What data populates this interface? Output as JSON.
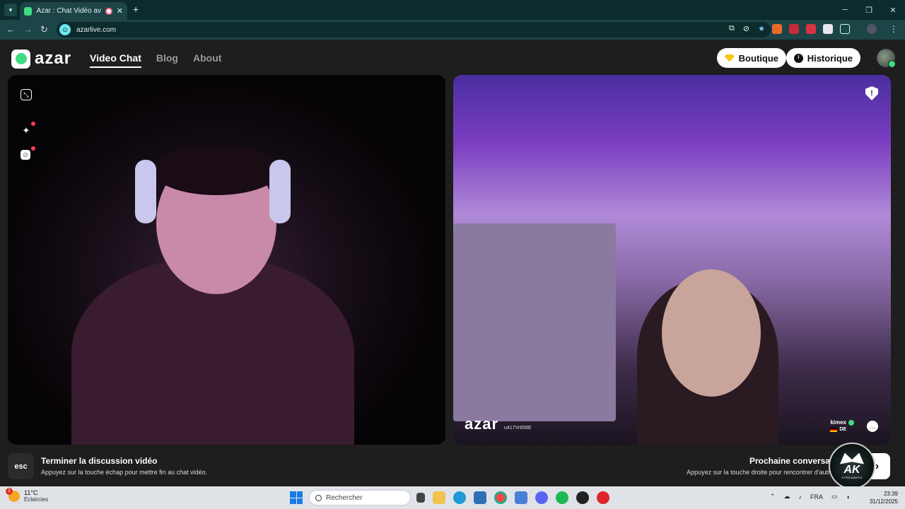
{
  "browser": {
    "tab_title": "Azar : Chat Vidéo avec de",
    "url": "azarlive.com"
  },
  "header": {
    "logo": "azar",
    "nav": {
      "video_chat": "Video Chat",
      "blog": "Blog",
      "about": "About"
    },
    "boutique_label": "Boutique",
    "historique_label": "Historique"
  },
  "remote_video": {
    "watermark": "azar",
    "user_code": "u417Vr656E",
    "peer_name": "kimex",
    "peer_country": "DE"
  },
  "footer": {
    "esc_key": "esc",
    "end_title": "Terminer la discussion vidéo",
    "end_sub": "Appuyez sur la touche échap pour mettre fin au chat vidéo.",
    "next_title": "Prochaine conversation",
    "next_sub": "Appuyez sur la touche droite pour rencontrer d'autres pe",
    "badge_text": "AK",
    "badge_sub": "STREAMERS"
  },
  "taskbar": {
    "weather_temp": "11°C",
    "weather_desc": "Eclaircies",
    "weather_badge": "1",
    "search_placeholder": "Rechercher",
    "lang": "FRA",
    "time": "23:39",
    "date": "31/12/2025"
  },
  "colors": {
    "brand_green": "#3ddc84",
    "browser_dark": "#0b2b2d",
    "browser_mid": "#1d4447",
    "app_bg": "#1e1e1e",
    "alert_red": "#ff3b5c"
  }
}
